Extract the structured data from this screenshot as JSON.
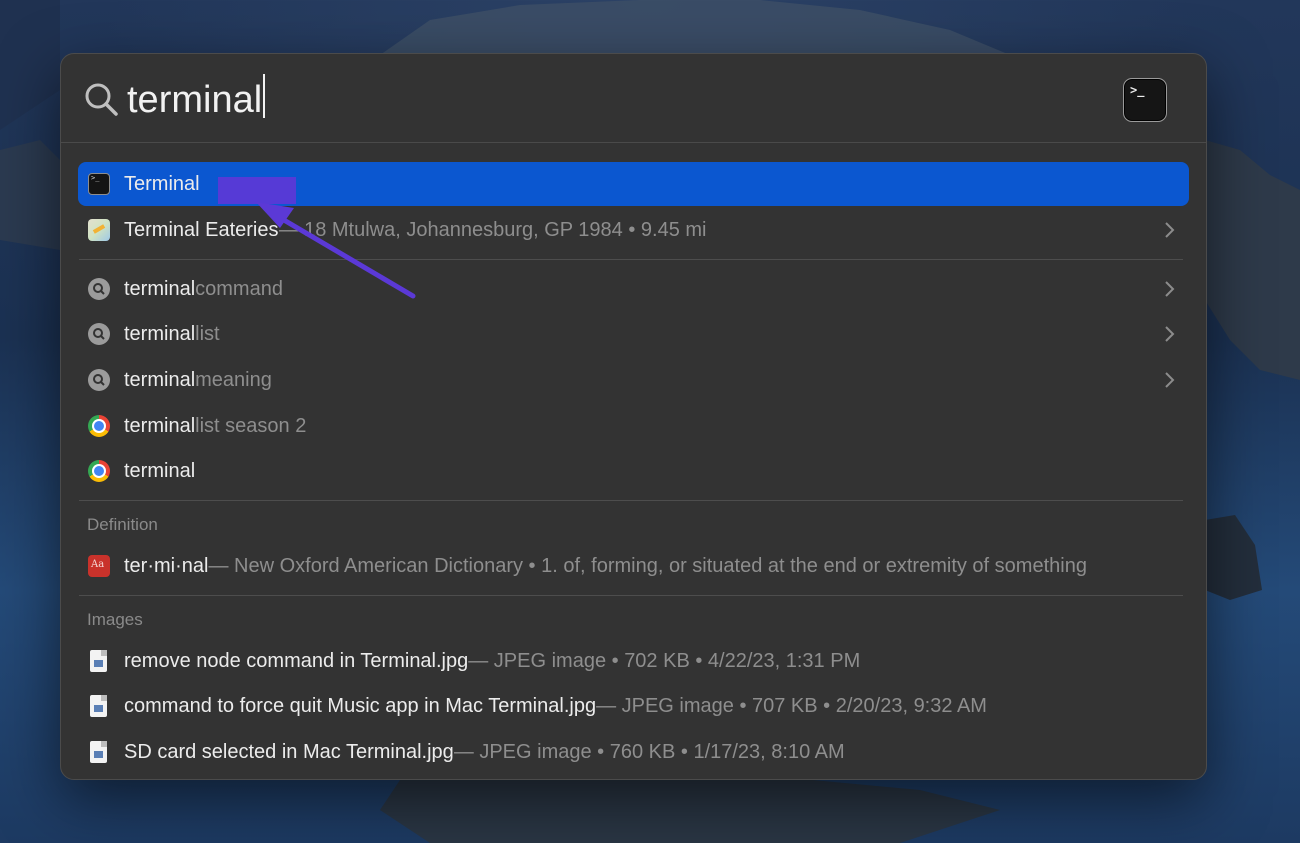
{
  "search": {
    "query": "terminal"
  },
  "results": [
    {
      "title": "Terminal",
      "rest": "",
      "meta": "",
      "icon": "terminal-app-icon",
      "selected": true,
      "chevron": false
    },
    {
      "title": "Terminal Eateries",
      "rest": "",
      "meta": " — 18 Mtulwa, Johannesburg, GP 1984 • 9.45 mi",
      "icon": "maps-icon",
      "selected": false,
      "chevron": true
    },
    {
      "title": "terminal",
      "rest": " command",
      "meta": "",
      "icon": "web-search-icon",
      "selected": false,
      "chevron": true
    },
    {
      "title": "terminal",
      "rest": " list",
      "meta": "",
      "icon": "web-search-icon",
      "selected": false,
      "chevron": true
    },
    {
      "title": "terminal",
      "rest": " meaning",
      "meta": "",
      "icon": "web-search-icon",
      "selected": false,
      "chevron": true
    },
    {
      "title": "terminal",
      "rest": " list season 2",
      "meta": "",
      "icon": "chrome-icon",
      "selected": false,
      "chevron": false
    },
    {
      "title": "terminal",
      "rest": "",
      "meta": "",
      "icon": "chrome-icon",
      "selected": false,
      "chevron": false
    }
  ],
  "definition": {
    "label": "Definition",
    "icon_text": "Aa",
    "title": "ter·mi·nal",
    "meta": " — New Oxford American Dictionary • 1. of, forming, or situated at the end or extremity of something"
  },
  "images": {
    "label": "Images",
    "items": [
      {
        "title": "remove node command in Terminal.jpg",
        "meta": " — JPEG image • 702 KB • 4/22/23, 1:31 PM"
      },
      {
        "title": "command to force quit Music app in Mac Terminal.jpg",
        "meta": " — JPEG image • 707 KB • 2/20/23, 9:32 AM"
      },
      {
        "title": "SD card selected in Mac Terminal.jpg",
        "meta": " — JPEG image • 760 KB • 1/17/23, 8:10 AM"
      }
    ]
  },
  "colors": {
    "selection": "#0b57d0",
    "panel": "#333333",
    "annotation": "#5b39d6"
  }
}
